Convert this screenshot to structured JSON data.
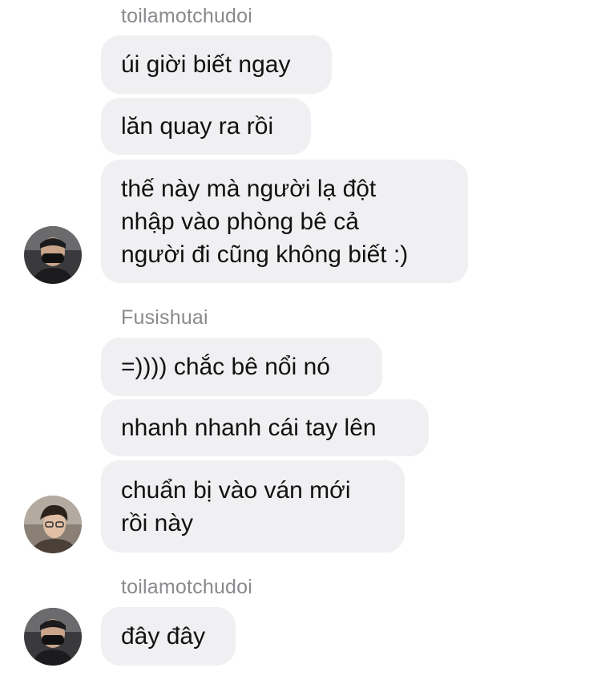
{
  "groups": [
    {
      "sender": "toilamotchudoi",
      "messages": [
        "úi giời biết ngay",
        "lăn quay ra rồi",
        "thế này mà người lạ đột\nnhập vào phòng bê cả\nngười đi cũng không biết :)"
      ]
    },
    {
      "sender": "Fusishuai",
      "messages": [
        "=)))) chắc bê nổi nó",
        "nhanh nhanh cái tay lên",
        "chuẩn bị vào ván mới\nrồi này"
      ]
    },
    {
      "sender": "toilamotchudoi",
      "messages": [
        "đây đây"
      ]
    }
  ],
  "colors": {
    "bubble": "#f0f0f2",
    "sender_text": "#8a8a8e",
    "message_text": "#111111"
  }
}
